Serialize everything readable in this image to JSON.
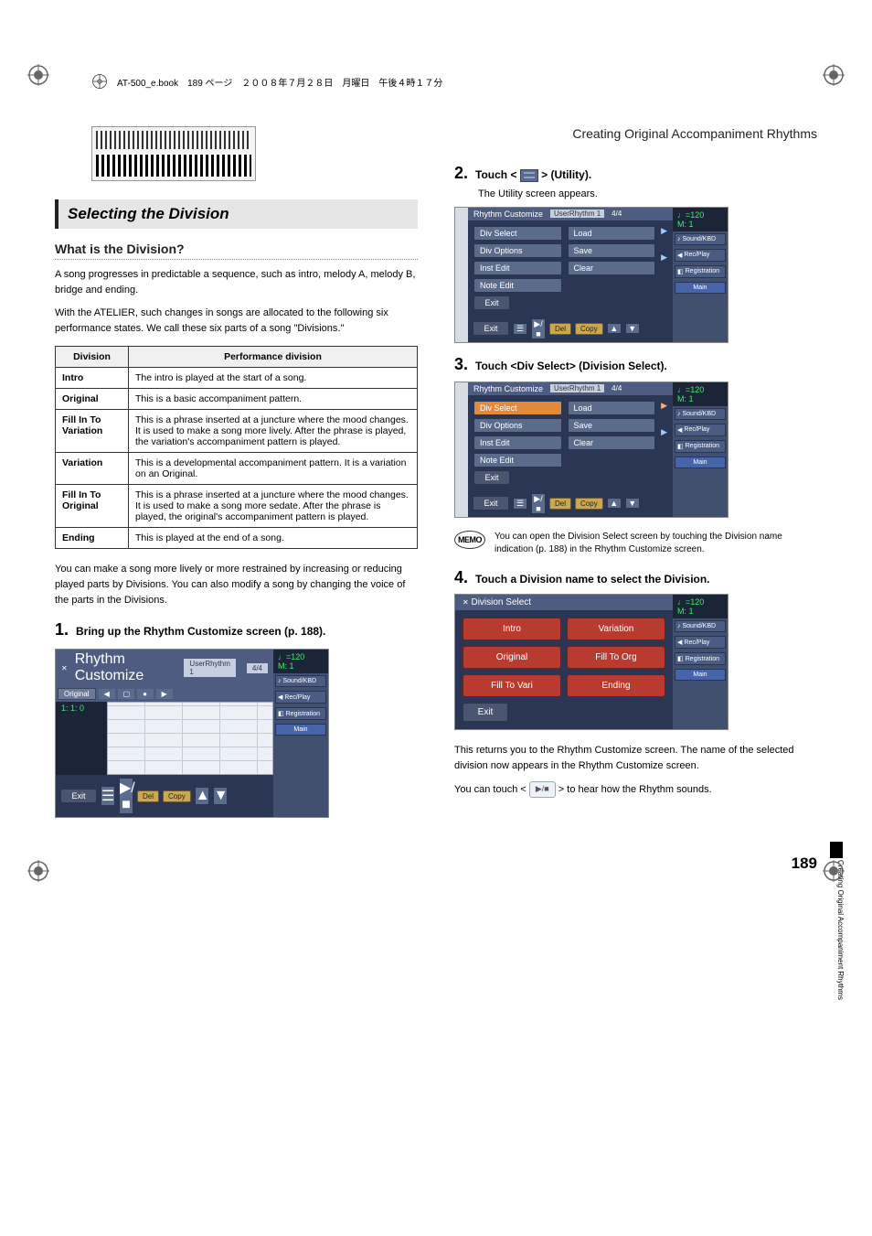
{
  "header_bar": "AT-500_e.book　189 ページ　２００８年７月２８日　月曜日　午後４時１７分",
  "chapter_title": "Creating Original Accompaniment Rhythms",
  "section_header": "Selecting the Division",
  "subheading": "What is the Division?",
  "para1": "A song progresses in predictable a sequence, such as intro, melody A, melody B, bridge and ending.",
  "para2": "With the ATELIER, such changes in songs are allocated to the following six performance states. We call these six parts of a song \"Divisions.\"",
  "table": {
    "head_division": "Division",
    "head_perf": "Performance division",
    "rows": [
      {
        "name": "Intro",
        "desc": "The intro is played at the start of a song."
      },
      {
        "name": "Original",
        "desc": "This is a basic accompaniment pattern."
      },
      {
        "name": "Fill In To Variation",
        "desc": "This is a phrase inserted at a juncture where the mood changes.\nIt is used to make a song more lively. After the phrase is played, the variation's accompaniment pattern is played."
      },
      {
        "name": "Variation",
        "desc": "This is a developmental accompaniment pattern. It is a variation on an Original."
      },
      {
        "name": "Fill In To Original",
        "desc": "This is a phrase inserted at a juncture where the mood changes.\nIt is used to make a song more sedate. After the phrase is played, the original's accompaniment pattern is played."
      },
      {
        "name": "Ending",
        "desc": "This is played at the end of a song."
      }
    ]
  },
  "para3": "You can make a song more lively or more restrained by increasing or reducing played parts by Divisions. You can also modify a song by changing the voice of the parts in the Divisions.",
  "step1": {
    "num": "1.",
    "text": "Bring up the Rhythm Customize screen (p. 188)."
  },
  "step2": {
    "num": "2.",
    "text_pre": "Touch <",
    "text_post": "> (Utility).",
    "sub": "The Utility screen appears."
  },
  "step3": {
    "num": "3.",
    "text": "Touch <Div Select> (Division Select)."
  },
  "step4": {
    "num": "4.",
    "text": "Touch a Division name to select the Division."
  },
  "memo_text": "You can open the Division Select screen by touching the Division name indication (p. 188) in the Rhythm Customize screen.",
  "memo_label": "MEMO",
  "after_divsel": "This returns you to the Rhythm Customize screen. The name of the selected division now appears in the Rhythm Customize screen.",
  "hear_pre": "You can touch <",
  "hear_post": "> to hear how the Rhythm sounds.",
  "play_icon": "▶/■",
  "rhythm_ss": {
    "title": "Rhythm Customize",
    "tab1": "UserRhythm 1",
    "tab2": "4/4",
    "original": "Original",
    "counter": "1: 1: 0",
    "exit": "Exit",
    "del": "Del",
    "copy": "Copy"
  },
  "utility_ss": {
    "title": "Rhythm Customize",
    "tab1": "UserRhythm 1",
    "tab2": "4/4",
    "menu_left": [
      "Div Select",
      "Div Options",
      "Inst Edit",
      "Note Edit"
    ],
    "menu_right": [
      "Load",
      "Save",
      "Clear"
    ],
    "exit": "Exit",
    "del": "Del",
    "copy": "Copy",
    "tempo": "♩=120",
    "measure": "M:    1",
    "side": [
      "Sound/KBD",
      "Rec/Play",
      "Registration",
      "Main"
    ]
  },
  "divsel_ss": {
    "title": "Division Select",
    "buttons": [
      "Intro",
      "Variation",
      "Original",
      "Fill To Org",
      "Fill To Vari",
      "Ending"
    ],
    "exit": "Exit",
    "tempo": "♩=120",
    "measure": "M:    1",
    "side": [
      "Sound/KBD",
      "Rec/Play",
      "Registration",
      "Main"
    ]
  },
  "side_text": "Creating Original Accompaniment Rhythms",
  "page_num": "189"
}
